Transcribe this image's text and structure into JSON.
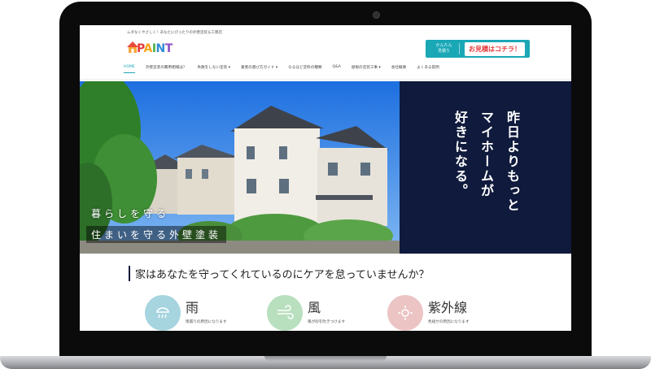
{
  "site": {
    "tagline": "ムダなくやさしく！あなたにぴったりの外壁塗装＆工務店",
    "logo_text": [
      "P",
      "A",
      "I",
      "N",
      "T"
    ]
  },
  "header": {
    "estimate_small": "かんたん\n見積り",
    "estimate_main": "お見積はコチラ！"
  },
  "nav": {
    "items": [
      {
        "label": "HOME"
      },
      {
        "label": "外壁塗装の費用相場は？"
      },
      {
        "label": "失敗をしない塗装 ▾"
      },
      {
        "label": "業者の選び方ガイド ▾"
      },
      {
        "label": "なるほど塗料の種類"
      },
      {
        "label": "Q&A"
      },
      {
        "label": "屋根の塗装工事 ▾"
      },
      {
        "label": "会社概要"
      },
      {
        "label": "よくある質問"
      }
    ]
  },
  "hero": {
    "vertical_col1": "昨日よりもっと",
    "vertical_col2": "マイホームが",
    "vertical_col3": "好きになる。",
    "caption1": "暮らしを守る",
    "caption2": "住まいを守る外壁塗装"
  },
  "section": {
    "title": "家はあなたを守ってくれているのにケアを怠っていませんか？"
  },
  "features": [
    {
      "title": "雨",
      "desc": "雨漏りの原因になります",
      "icon": "rain-icon",
      "color": "#a6d4df"
    },
    {
      "title": "風",
      "desc": "風が砂を吹きつけます",
      "icon": "wind-icon",
      "color": "#b8dfbe"
    },
    {
      "title": "紫外線",
      "desc": "色褪せの原因になります",
      "icon": "uv-icon",
      "color": "#ecc4c4"
    }
  ],
  "colors": {
    "accent": "#1aa7b6",
    "hero_panel": "#0f1a3c",
    "estimate_text": "#e13a3a"
  }
}
